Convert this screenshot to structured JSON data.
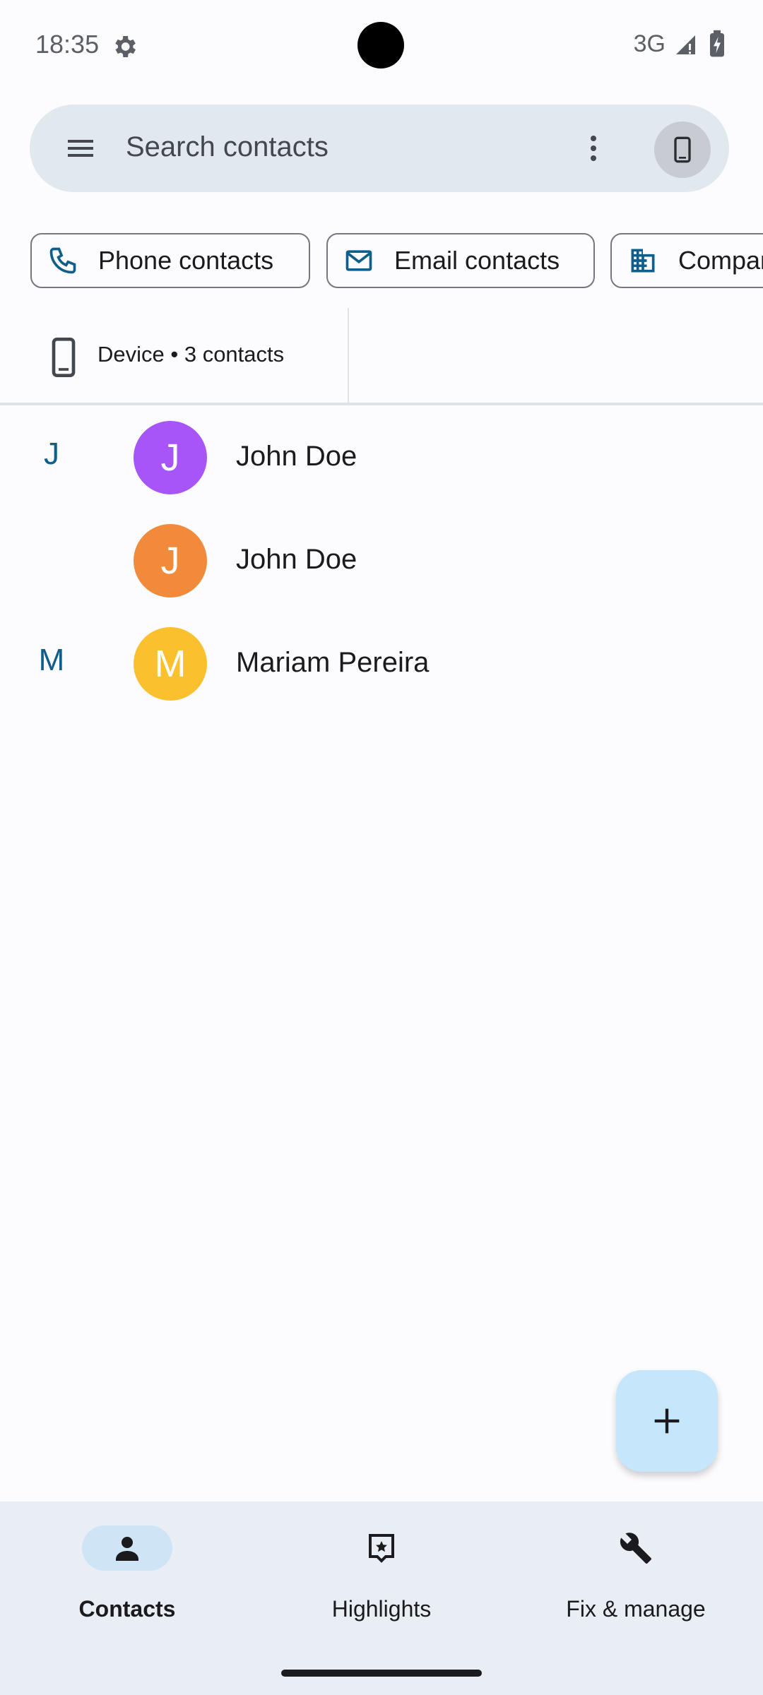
{
  "status_bar": {
    "time": "18:35",
    "network": "3G",
    "icons": [
      "settings-gear-icon",
      "signal-icon",
      "battery-charging-icon"
    ]
  },
  "search": {
    "placeholder": "Search contacts",
    "menu_icon": "hamburger-menu-icon",
    "more_icon": "more-vert-icon",
    "account_icon": "phone-device-icon"
  },
  "filters": [
    {
      "label": "Phone contacts",
      "icon": "phone-icon"
    },
    {
      "label": "Email contacts",
      "icon": "mail-icon"
    },
    {
      "label": "Company",
      "icon": "business-icon"
    }
  ],
  "account": {
    "label": "Device • 3 contacts",
    "icon": "phone-device-icon"
  },
  "contacts": [
    {
      "section": "J",
      "initial": "J",
      "name": "John Doe",
      "color": "#a855f7"
    },
    {
      "section": "",
      "initial": "J",
      "name": "John Doe",
      "color": "#f28a3c"
    },
    {
      "section": "M",
      "initial": "M",
      "name": "Mariam Pereira",
      "color": "#fbc02d"
    }
  ],
  "fab": {
    "icon": "plus-icon"
  },
  "bottom_nav": [
    {
      "label": "Contacts",
      "icon": "person-icon",
      "active": true
    },
    {
      "label": "Highlights",
      "icon": "highlights-icon",
      "active": false
    },
    {
      "label": "Fix & manage",
      "icon": "wrench-icon",
      "active": false
    }
  ],
  "colors": {
    "accent": "#0f5f8a",
    "search_bg": "#e1e8ee",
    "nav_bg": "#e8eef4",
    "fab_bg": "#c5e6fb"
  }
}
